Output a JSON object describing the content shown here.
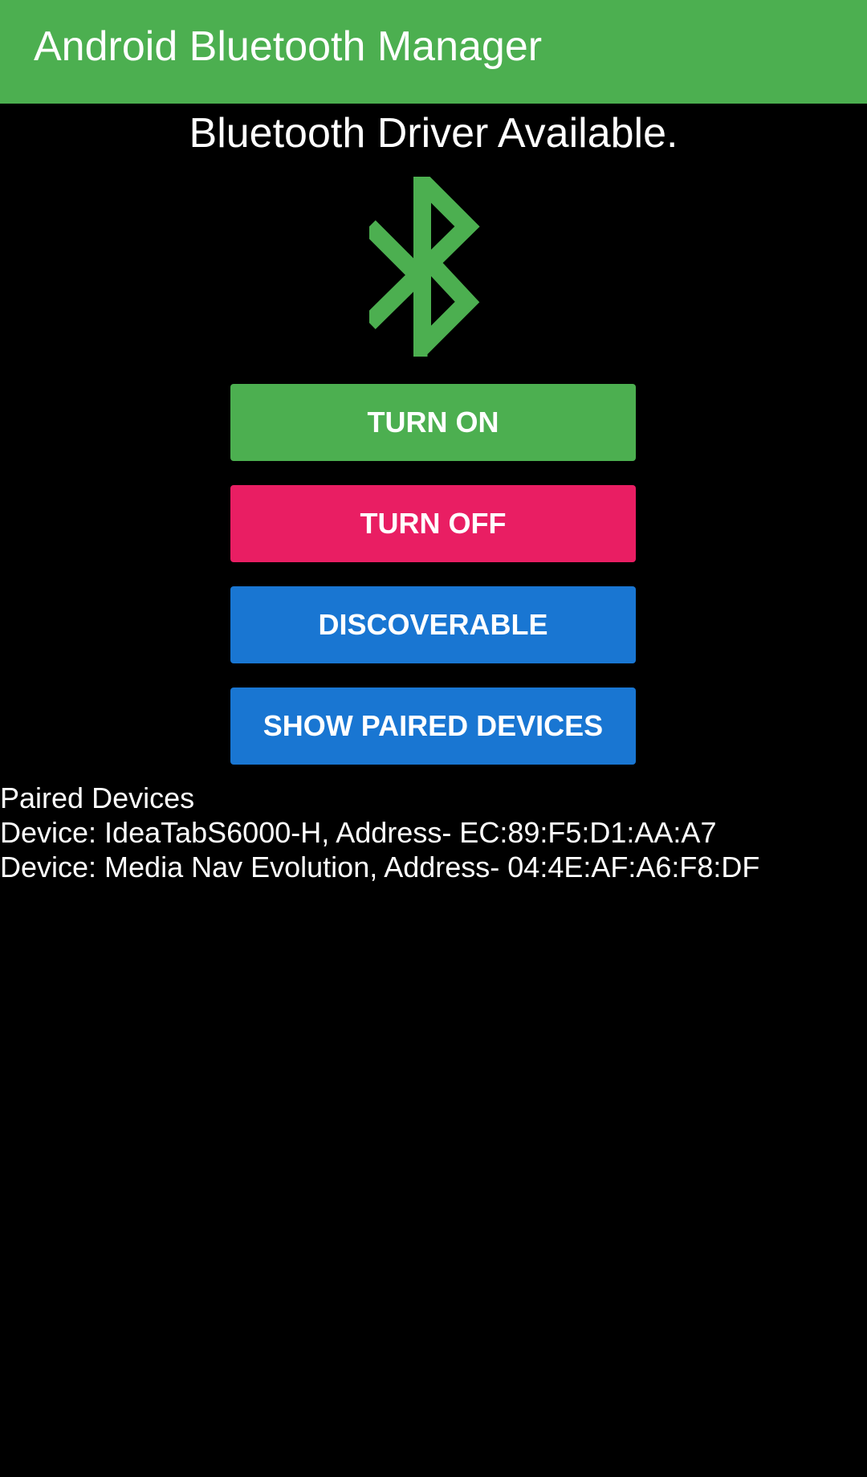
{
  "app_bar": {
    "title": "Android Bluetooth Manager",
    "color": "#4CAF50"
  },
  "status": {
    "text": "Bluetooth Driver Available."
  },
  "icon": {
    "name": "bluetooth-icon",
    "color": "#4CAF50"
  },
  "buttons": {
    "turn_on": {
      "label": "TURN ON",
      "color": "#4CAF50"
    },
    "turn_off": {
      "label": "TURN OFF",
      "color": "#E91E63"
    },
    "discoverable": {
      "label": "DISCOVERABLE",
      "color": "#1976D2"
    },
    "show_paired": {
      "label": "SHOW PAIRED DEVICES",
      "color": "#1976D2"
    }
  },
  "paired_devices": {
    "heading": "Paired Devices",
    "items": [
      {
        "text": "Device: IdeaTabS6000-H, Address- EC:89:F5:D1:AA:A7"
      },
      {
        "text": "Device: Media Nav Evolution, Address- 04:4E:AF:A6:F8:DF"
      }
    ]
  }
}
